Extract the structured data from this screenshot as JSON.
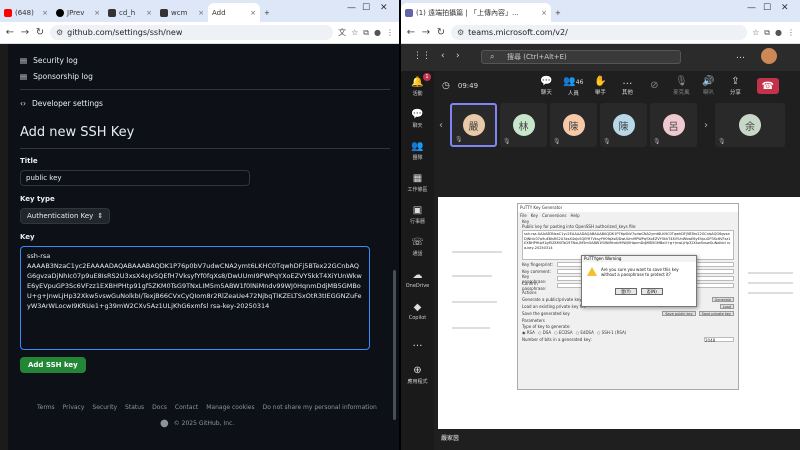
{
  "left": {
    "tabs": [
      {
        "label": "(648)",
        "color": "#ff0000"
      },
      {
        "label": "JPrev",
        "color": "#000000"
      },
      {
        "label": "cd_h",
        "color": "#000000"
      },
      {
        "label": "wcm",
        "color": "#000000"
      },
      {
        "label": "Add",
        "color": "#000000",
        "active": true
      }
    ],
    "url": "github.com/settings/ssh/new",
    "sidebar": {
      "security_log": "Security log",
      "sponsorship_log": "Sponsorship log",
      "developer_settings": "Developer settings"
    },
    "title": "Add new SSH Key",
    "title_label": "Title",
    "title_value": "public key",
    "key_type_label": "Key type",
    "key_type_value": "Authentication Key",
    "key_label": "Key",
    "key_value": "ssh-rsa\nAAAAB3NzaC1yc2EAAAADAQABAAABAQDK1P76p0bV7udwCNA2ymt6LKHC0TqwhDFj5BTex22GCnbAQG6gvzaDjNhIc07p9uE8IsRS2U3xsX4xJvSQEfH7VksyfYf0fqXs8/DwUUmI9PWPqYXoEZVY5kkT4XiYUnWkwE6yEVpuGP3Sc6VFzz1EXBHPHtp91gf5ZKM0TsG9TNxLIM5m5ABW1f0lNiMndv99WJ0HqnmDdjMB5GMBoU+g+JnwLjHp32Xkw5vswGuNolkbI/TexjB66CVxCyQIom8r2RlZeaUe472NjbqTIKZELTSxOtR3tIEGGNZuFeyW3ArWLocwI9KRUe1+g39mW2CXv5Az1ULjKhG6xmfsl rsa-key-20250314",
    "add_button": "Add SSH key",
    "footer_links": [
      "Terms",
      "Privacy",
      "Security",
      "Status",
      "Docs",
      "Contact",
      "Manage cookies",
      "Do not share my personal information"
    ],
    "copyright": "© 2025 GitHub, Inc."
  },
  "right": {
    "tab_label": "(1) 遠端拍攝篇 | 「上傳內容」...",
    "url": "teams.microsoft.com/v2/",
    "search_placeholder": "搜尋 (Ctrl+Alt+E)",
    "rail": [
      "活動",
      "聊天",
      "團隊",
      "工作條區",
      "行事曆",
      "通話",
      "OneDrive",
      "Copilot",
      "應用程式"
    ],
    "rail_badge": "1",
    "timer": "09:49",
    "controls": [
      {
        "label": "聊天",
        "icon": "chat-icon"
      },
      {
        "label": "人員",
        "icon": "people-icon",
        "count": "46"
      },
      {
        "label": "舉手",
        "icon": "hand-icon"
      },
      {
        "label": "其他",
        "icon": "more-icon"
      },
      {
        "label": "",
        "icon": "camera-icon"
      },
      {
        "label": "麥克風",
        "icon": "mic-icon"
      },
      {
        "label": "喇叭",
        "icon": "speaker-icon"
      },
      {
        "label": "分享",
        "icon": "share-icon"
      }
    ],
    "participants": [
      {
        "initial": "嚴",
        "color": "#e8c9a8",
        "active": true
      },
      {
        "initial": "林",
        "color": "#c8e6c9"
      },
      {
        "initial": "陳",
        "color": "#f8c9a8"
      },
      {
        "initial": "陳",
        "color": "#b8d8e8"
      },
      {
        "initial": "呂",
        "color": "#f0c8d0"
      },
      {
        "initial": "余",
        "color": "#c8d8c8"
      }
    ],
    "presenter_label": "嚴家茵",
    "putty": {
      "title": "PuTTY Key Generator",
      "menus": [
        "File",
        "Key",
        "Conversions",
        "Help"
      ],
      "key_section": "Key",
      "public_key_label": "Public key for pasting into OpenSSH authorized_keys file:",
      "public_key_text": "ssh-rsa AAAAB3NzaC1yc2EAAAADAQABAAABAQDK1P76p0bV7udwCNA2ymt6LKHC0TqwhDFj5BTex22GCnbAQG6gvzaDjNhIc07p9uE8IsRS2U3xsX4xJvSQEfH7VksyfYf0fqXs8/DwUUmI9PWPqYXoEZVY5kkT4XiYUnWkwE6yEVpuGP3Sc6VFzz1EXBHPHtp91gf5ZKM0TsG9TNxLIM5m5ABW1f0lNiMndv99WJ0HqnmDdjMB5GMBoU+g+JnwLjHp32Xkw5vswGuNolkbI rsa-key-20250314",
      "fingerprint_label": "Key fingerprint:",
      "comment_label": "Key comment:",
      "passphrase_label": "Key passphrase:",
      "confirm_label": "Confirm passphrase:",
      "actions_label": "Actions",
      "generate_label": "Generate a public/private key pair",
      "generate_btn": "Generate",
      "load_label": "Load an existing private key file",
      "load_btn": "Load",
      "save_label": "Save the generated key",
      "save_pub_btn": "Save public key",
      "save_priv_btn": "Save private key",
      "params_label": "Parameters",
      "type_label": "Type of key to generate:",
      "types": [
        "RSA",
        "DSA",
        "ECDSA",
        "EdDSA",
        "SSH-1 (RSA)"
      ],
      "bits_label": "Number of bits in a generated key:",
      "bits_value": "2048"
    },
    "warning": {
      "title": "PuTTYgen Warning",
      "message": "Are you sure you want to save this key without a passphrase to protect it?",
      "yes": "是(Y)",
      "no": "否(N)"
    }
  },
  "colors": {
    "github_bg": "#0d1117",
    "teams_bg": "#1f1f1f",
    "leave": "#c4314b",
    "green": "#238636"
  }
}
